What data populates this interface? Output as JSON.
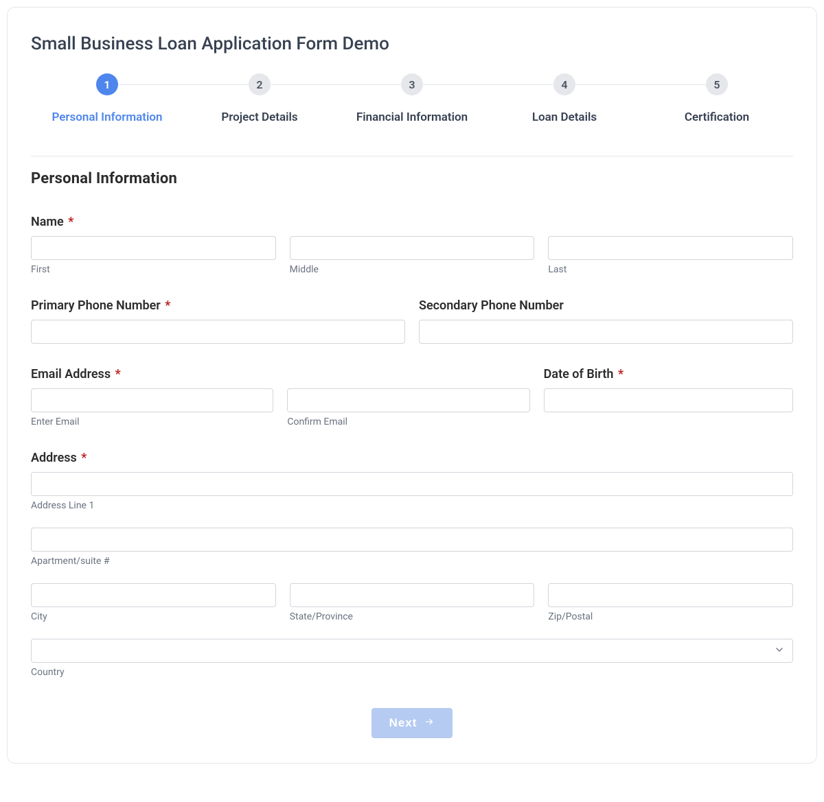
{
  "form": {
    "title": "Small Business Loan Application Form Demo",
    "steps": [
      {
        "number": "1",
        "label": "Personal Information",
        "active": true
      },
      {
        "number": "2",
        "label": "Project Details",
        "active": false
      },
      {
        "number": "3",
        "label": "Financial Information",
        "active": false
      },
      {
        "number": "4",
        "label": "Loan Details",
        "active": false
      },
      {
        "number": "5",
        "label": "Certification",
        "active": false
      }
    ],
    "section_title": "Personal Information",
    "required_marker": "*",
    "fields": {
      "name": {
        "label": "Name",
        "required": true,
        "first_sub": "First",
        "middle_sub": "Middle",
        "last_sub": "Last"
      },
      "primary_phone": {
        "label": "Primary Phone Number",
        "required": true
      },
      "secondary_phone": {
        "label": "Secondary Phone Number",
        "required": false
      },
      "email": {
        "label": "Email Address",
        "required": true,
        "enter_sub": "Enter Email",
        "confirm_sub": "Confirm Email"
      },
      "dob": {
        "label": "Date of Birth",
        "required": true
      },
      "address": {
        "label": "Address",
        "required": true,
        "line1_sub": "Address Line 1",
        "line2_sub": "Apartment/suite #",
        "city_sub": "City",
        "state_sub": "State/Province",
        "zip_sub": "Zip/Postal",
        "country_sub": "Country"
      }
    },
    "next_button_label": "Next"
  }
}
